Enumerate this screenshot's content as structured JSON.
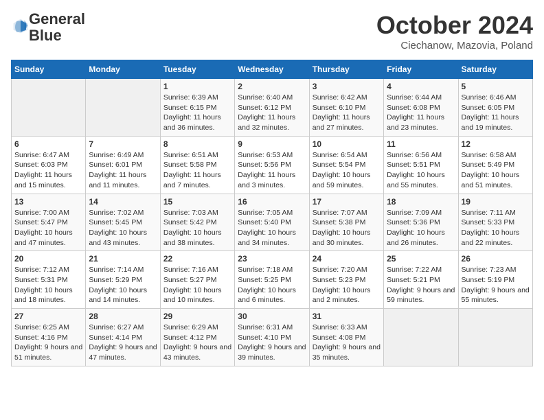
{
  "header": {
    "logo_line1": "General",
    "logo_line2": "Blue",
    "month_title": "October 2024",
    "location": "Ciechanow, Mazovia, Poland"
  },
  "days_of_week": [
    "Sunday",
    "Monday",
    "Tuesday",
    "Wednesday",
    "Thursday",
    "Friday",
    "Saturday"
  ],
  "weeks": [
    [
      {
        "day": "",
        "info": ""
      },
      {
        "day": "",
        "info": ""
      },
      {
        "day": "1",
        "info": "Sunrise: 6:39 AM\nSunset: 6:15 PM\nDaylight: 11 hours and 36 minutes."
      },
      {
        "day": "2",
        "info": "Sunrise: 6:40 AM\nSunset: 6:12 PM\nDaylight: 11 hours and 32 minutes."
      },
      {
        "day": "3",
        "info": "Sunrise: 6:42 AM\nSunset: 6:10 PM\nDaylight: 11 hours and 27 minutes."
      },
      {
        "day": "4",
        "info": "Sunrise: 6:44 AM\nSunset: 6:08 PM\nDaylight: 11 hours and 23 minutes."
      },
      {
        "day": "5",
        "info": "Sunrise: 6:46 AM\nSunset: 6:05 PM\nDaylight: 11 hours and 19 minutes."
      }
    ],
    [
      {
        "day": "6",
        "info": "Sunrise: 6:47 AM\nSunset: 6:03 PM\nDaylight: 11 hours and 15 minutes."
      },
      {
        "day": "7",
        "info": "Sunrise: 6:49 AM\nSunset: 6:01 PM\nDaylight: 11 hours and 11 minutes."
      },
      {
        "day": "8",
        "info": "Sunrise: 6:51 AM\nSunset: 5:58 PM\nDaylight: 11 hours and 7 minutes."
      },
      {
        "day": "9",
        "info": "Sunrise: 6:53 AM\nSunset: 5:56 PM\nDaylight: 11 hours and 3 minutes."
      },
      {
        "day": "10",
        "info": "Sunrise: 6:54 AM\nSunset: 5:54 PM\nDaylight: 10 hours and 59 minutes."
      },
      {
        "day": "11",
        "info": "Sunrise: 6:56 AM\nSunset: 5:51 PM\nDaylight: 10 hours and 55 minutes."
      },
      {
        "day": "12",
        "info": "Sunrise: 6:58 AM\nSunset: 5:49 PM\nDaylight: 10 hours and 51 minutes."
      }
    ],
    [
      {
        "day": "13",
        "info": "Sunrise: 7:00 AM\nSunset: 5:47 PM\nDaylight: 10 hours and 47 minutes."
      },
      {
        "day": "14",
        "info": "Sunrise: 7:02 AM\nSunset: 5:45 PM\nDaylight: 10 hours and 43 minutes."
      },
      {
        "day": "15",
        "info": "Sunrise: 7:03 AM\nSunset: 5:42 PM\nDaylight: 10 hours and 38 minutes."
      },
      {
        "day": "16",
        "info": "Sunrise: 7:05 AM\nSunset: 5:40 PM\nDaylight: 10 hours and 34 minutes."
      },
      {
        "day": "17",
        "info": "Sunrise: 7:07 AM\nSunset: 5:38 PM\nDaylight: 10 hours and 30 minutes."
      },
      {
        "day": "18",
        "info": "Sunrise: 7:09 AM\nSunset: 5:36 PM\nDaylight: 10 hours and 26 minutes."
      },
      {
        "day": "19",
        "info": "Sunrise: 7:11 AM\nSunset: 5:33 PM\nDaylight: 10 hours and 22 minutes."
      }
    ],
    [
      {
        "day": "20",
        "info": "Sunrise: 7:12 AM\nSunset: 5:31 PM\nDaylight: 10 hours and 18 minutes."
      },
      {
        "day": "21",
        "info": "Sunrise: 7:14 AM\nSunset: 5:29 PM\nDaylight: 10 hours and 14 minutes."
      },
      {
        "day": "22",
        "info": "Sunrise: 7:16 AM\nSunset: 5:27 PM\nDaylight: 10 hours and 10 minutes."
      },
      {
        "day": "23",
        "info": "Sunrise: 7:18 AM\nSunset: 5:25 PM\nDaylight: 10 hours and 6 minutes."
      },
      {
        "day": "24",
        "info": "Sunrise: 7:20 AM\nSunset: 5:23 PM\nDaylight: 10 hours and 2 minutes."
      },
      {
        "day": "25",
        "info": "Sunrise: 7:22 AM\nSunset: 5:21 PM\nDaylight: 9 hours and 59 minutes."
      },
      {
        "day": "26",
        "info": "Sunrise: 7:23 AM\nSunset: 5:19 PM\nDaylight: 9 hours and 55 minutes."
      }
    ],
    [
      {
        "day": "27",
        "info": "Sunrise: 6:25 AM\nSunset: 4:16 PM\nDaylight: 9 hours and 51 minutes."
      },
      {
        "day": "28",
        "info": "Sunrise: 6:27 AM\nSunset: 4:14 PM\nDaylight: 9 hours and 47 minutes."
      },
      {
        "day": "29",
        "info": "Sunrise: 6:29 AM\nSunset: 4:12 PM\nDaylight: 9 hours and 43 minutes."
      },
      {
        "day": "30",
        "info": "Sunrise: 6:31 AM\nSunset: 4:10 PM\nDaylight: 9 hours and 39 minutes."
      },
      {
        "day": "31",
        "info": "Sunrise: 6:33 AM\nSunset: 4:08 PM\nDaylight: 9 hours and 35 minutes."
      },
      {
        "day": "",
        "info": ""
      },
      {
        "day": "",
        "info": ""
      }
    ]
  ]
}
